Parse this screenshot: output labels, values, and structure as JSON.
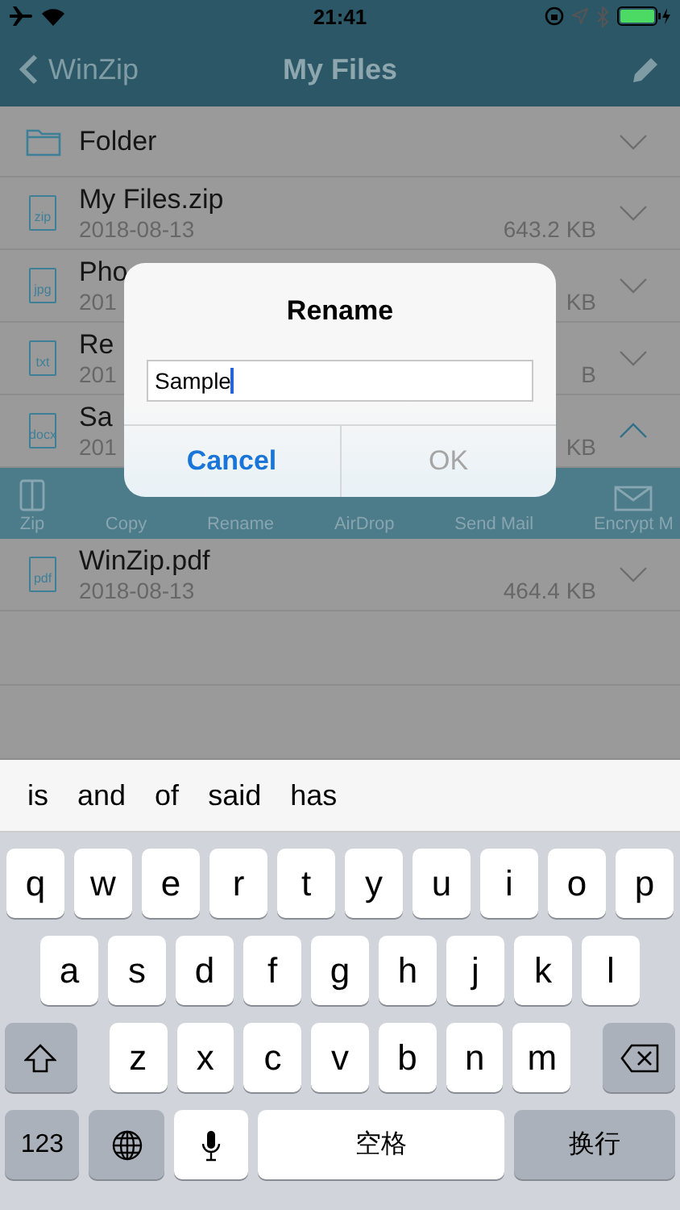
{
  "status_bar": {
    "time": "21:41"
  },
  "nav": {
    "back": "WinZip",
    "title": "My Files"
  },
  "files": [
    {
      "kind": "folder",
      "name": "Folder",
      "expanded": false
    },
    {
      "kind": "file",
      "ext": "zip",
      "name": "My Files.zip",
      "date": "2018-08-13",
      "size": "643.2 KB",
      "expanded": false
    },
    {
      "kind": "file",
      "ext": "jpg",
      "name": "Pho",
      "date": "201",
      "size": "KB",
      "expanded": false
    },
    {
      "kind": "file",
      "ext": "txt",
      "name": "Re",
      "date": "201",
      "size": "B",
      "expanded": false
    },
    {
      "kind": "file",
      "ext": "docx",
      "name": "Sa",
      "date": "201",
      "size": "KB",
      "expanded": true
    }
  ],
  "toolbar": [
    {
      "label": "Zip",
      "kind": "zip"
    },
    {
      "label": "Copy",
      "kind": "plain"
    },
    {
      "label": "Rename",
      "kind": "plain"
    },
    {
      "label": "AirDrop",
      "kind": "plain"
    },
    {
      "label": "Send Mail",
      "kind": "plain"
    },
    {
      "label": "Encrypt M",
      "kind": "mail"
    }
  ],
  "files_after": [
    {
      "ext": "pdf",
      "name": "WinZip.pdf",
      "date": "2018-08-13",
      "size": "464.4 KB",
      "expanded": false
    }
  ],
  "dialog": {
    "title": "Rename",
    "value": "Sample",
    "buttons": [
      {
        "label": "Cancel",
        "disabled": false
      },
      {
        "label": "OK",
        "disabled": true
      }
    ]
  },
  "suggestions": [
    "is",
    "and",
    "of",
    "said",
    "has"
  ],
  "keyboard": {
    "rows": [
      [
        "q",
        "w",
        "e",
        "r",
        "t",
        "y",
        "u",
        "i",
        "o",
        "p"
      ],
      [
        "a",
        "s",
        "d",
        "f",
        "g",
        "h",
        "j",
        "k",
        "l"
      ],
      [
        "z",
        "x",
        "c",
        "v",
        "b",
        "n",
        "m"
      ]
    ],
    "bottom": [
      {
        "kind": "text",
        "label": "123"
      },
      {
        "kind": "globe"
      },
      {
        "kind": "mic"
      },
      {
        "kind": "space",
        "label": "空格"
      },
      {
        "kind": "return",
        "label": "换行"
      }
    ]
  }
}
